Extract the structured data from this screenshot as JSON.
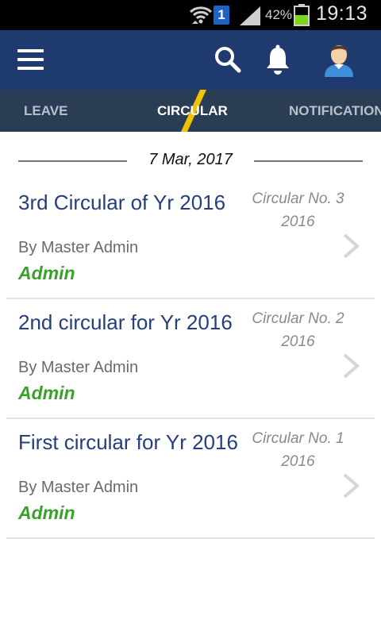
{
  "status_bar": {
    "sim_label": "1",
    "battery_percent": "42%",
    "time": "19:13"
  },
  "app_bar": {
    "icons": [
      "menu-icon",
      "search-icon",
      "bell-icon",
      "avatar"
    ]
  },
  "tabs": [
    {
      "label": "LEAVE",
      "active": false
    },
    {
      "label": "CIRCULAR",
      "active": true
    },
    {
      "label": "NOTIFICATION",
      "active": false
    }
  ],
  "list": {
    "date": "7 Mar, 2017",
    "items": [
      {
        "title": "3rd Circular of Yr 2016",
        "number_line1": "Circular No. 3",
        "number_line2": "2016",
        "author": "By Master Admin",
        "role": "Admin"
      },
      {
        "title": "2nd circular for Yr 2016",
        "number_line1": "Circular No. 2",
        "number_line2": "2016",
        "author": "By Master Admin",
        "role": "Admin"
      },
      {
        "title": "First circular for Yr 2016",
        "number_line1": "Circular No. 1",
        "number_line2": "2016",
        "author": "By Master Admin",
        "role": "Admin"
      }
    ]
  },
  "colors": {
    "app_bar": "#1e3a6e",
    "tab_bar": "#2b3c55",
    "tab_indicator": "#f2c200",
    "title_text": "#243f7c",
    "role_text": "#3aa12b"
  }
}
